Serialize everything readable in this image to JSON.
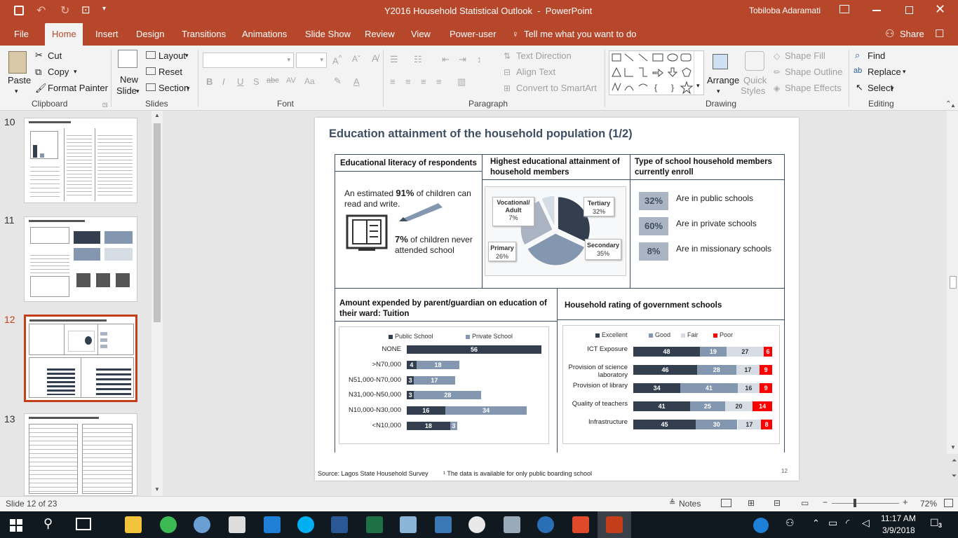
{
  "window": {
    "title": "Y2016 Household Statistical Outlook  -  PowerPoint",
    "user": "Tobiloba Adaramati"
  },
  "tabs": [
    "File",
    "Home",
    "Insert",
    "Design",
    "Transitions",
    "Animations",
    "Slide Show",
    "Review",
    "View",
    "Power-user"
  ],
  "tell_me": "Tell me what you want to do",
  "share": "Share",
  "ribbon": {
    "paste": "Paste",
    "cut": "Cut",
    "copy": "Copy",
    "format_painter": "Format Painter",
    "clipboard": "Clipboard",
    "new_slide_1": "New",
    "new_slide_2": "Slide",
    "layout": "Layout",
    "reset": "Reset",
    "section": "Section",
    "slides": "Slides",
    "font": "Font",
    "paragraph": "Paragraph",
    "text_direction": "Text Direction",
    "align_text": "Align Text",
    "convert_smartart": "Convert to SmartArt",
    "arrange": "Arrange",
    "quick_styles_1": "Quick",
    "quick_styles_2": "Styles",
    "shape_fill": "Shape Fill",
    "shape_outline": "Shape Outline",
    "shape_effects": "Shape Effects",
    "drawing": "Drawing",
    "find": "Find",
    "replace": "Replace",
    "select": "Select",
    "editing": "Editing"
  },
  "thumbs": [
    {
      "num": "10"
    },
    {
      "num": "11"
    },
    {
      "num": "12"
    },
    {
      "num": "13"
    }
  ],
  "status": {
    "slide": "Slide 12 of 23",
    "notes": "Notes",
    "zoom": "72%"
  },
  "taskbar": {
    "time": "11:17 AM",
    "date": "3/9/2018",
    "notif": "3"
  },
  "slide": {
    "title": "Education attainment of the household population (1/2)",
    "s1_title": "Educational literacy of respondents",
    "lit_pre": "An estimated ",
    "lit_pct": "91%",
    "lit_post": " of children can",
    "lit_line2": "read and write.",
    "never_pct": "7%",
    "never_l1": " of children never",
    "never_l2": "attended school",
    "s2_title_1": "Highest educational attainment of",
    "s2_title_2": "household members",
    "pie_labels": {
      "voc1": "Vocational/",
      "voc2": "Adult",
      "voc3": "7%",
      "ter1": "Tertiary",
      "ter2": "32%",
      "pri1": "Primary",
      "pri2": "26%",
      "sec1": "Secondary",
      "sec2": "35%"
    },
    "s3_title_1": "Type of school household members",
    "s3_title_2": "currently enroll",
    "enroll": [
      {
        "pct": "32%",
        "label": "Are in public schools"
      },
      {
        "pct": "60%",
        "label": "Are in private schools"
      },
      {
        "pct": "8%",
        "label": "Are in missionary schools"
      }
    ],
    "s4_title_1": "Amount expended by parent/guardian on education of",
    "s4_title_2": "their ward: Tuition",
    "s5_title": "Household rating of government schools",
    "source": "Source:  Lagos State Household Survey",
    "footnote": "¹ The data is available for only public boarding school",
    "page_num": "12"
  },
  "chart_data": [
    {
      "type": "pie",
      "title": "Highest educational attainment of household members",
      "categories": [
        "Tertiary",
        "Secondary",
        "Primary",
        "Vocational/Adult"
      ],
      "values": [
        32,
        35,
        26,
        7
      ]
    },
    {
      "type": "bar",
      "orientation": "horizontal",
      "stacked": true,
      "legend": "top",
      "categories": [
        "NONE",
        ">N70,000",
        "N51,000-N70,000",
        "N31,000-N50,000",
        "N10,000-N30,000",
        "<N10,000"
      ],
      "series": [
        {
          "name": "Public School",
          "color": "#333f4f",
          "values": [
            56,
            4,
            3,
            3,
            16,
            18
          ]
        },
        {
          "name": "Private School",
          "color": "#8497b0",
          "values": [
            null,
            18,
            17,
            28,
            34,
            3
          ]
        }
      ]
    },
    {
      "type": "bar",
      "orientation": "horizontal",
      "stacked": true,
      "legend": "top",
      "categories": [
        "ICT Exposure",
        "Provision of science laboratory",
        "Provision of library",
        "Quality of teachers",
        "Infrastructure"
      ],
      "series": [
        {
          "name": "Excellent",
          "color": "#333f4f",
          "values": [
            48,
            46,
            34,
            41,
            45
          ]
        },
        {
          "name": "Good",
          "color": "#8497b0",
          "values": [
            19,
            28,
            41,
            25,
            30
          ]
        },
        {
          "name": "Fair",
          "color": "#d6dce4",
          "values": [
            27,
            17,
            16,
            20,
            17
          ]
        },
        {
          "name": "Poor",
          "color": "#ff0000",
          "values": [
            6,
            9,
            9,
            14,
            8
          ]
        }
      ]
    }
  ]
}
